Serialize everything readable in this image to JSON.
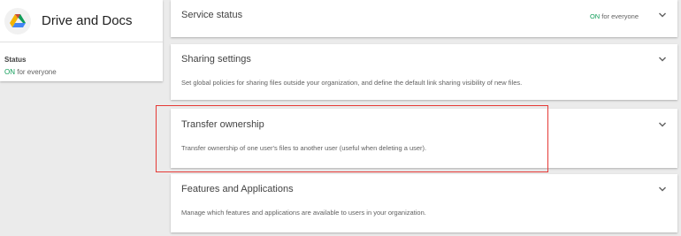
{
  "app": {
    "title": "Drive and Docs",
    "logo_icon": "google-drive-icon",
    "status_label": "Status",
    "status_on": "ON",
    "status_scope": " for everyone"
  },
  "cards": {
    "service_status": {
      "title": "Service status",
      "status_on": "ON",
      "status_scope": " for everyone"
    },
    "sharing_settings": {
      "title": "Sharing settings",
      "description": "Set global policies for sharing files outside your organization, and define the default link sharing visibility of new files."
    },
    "transfer_ownership": {
      "title": "Transfer ownership",
      "description": "Transfer ownership of one user's files to another user (useful when deleting a user)."
    },
    "features_applications": {
      "title": "Features and Applications",
      "description": "Manage which features and applications are available to users in your organization."
    }
  },
  "colors": {
    "status_on": "#0f9d58",
    "highlight_border": "#e53935",
    "background": "#ebebeb"
  }
}
